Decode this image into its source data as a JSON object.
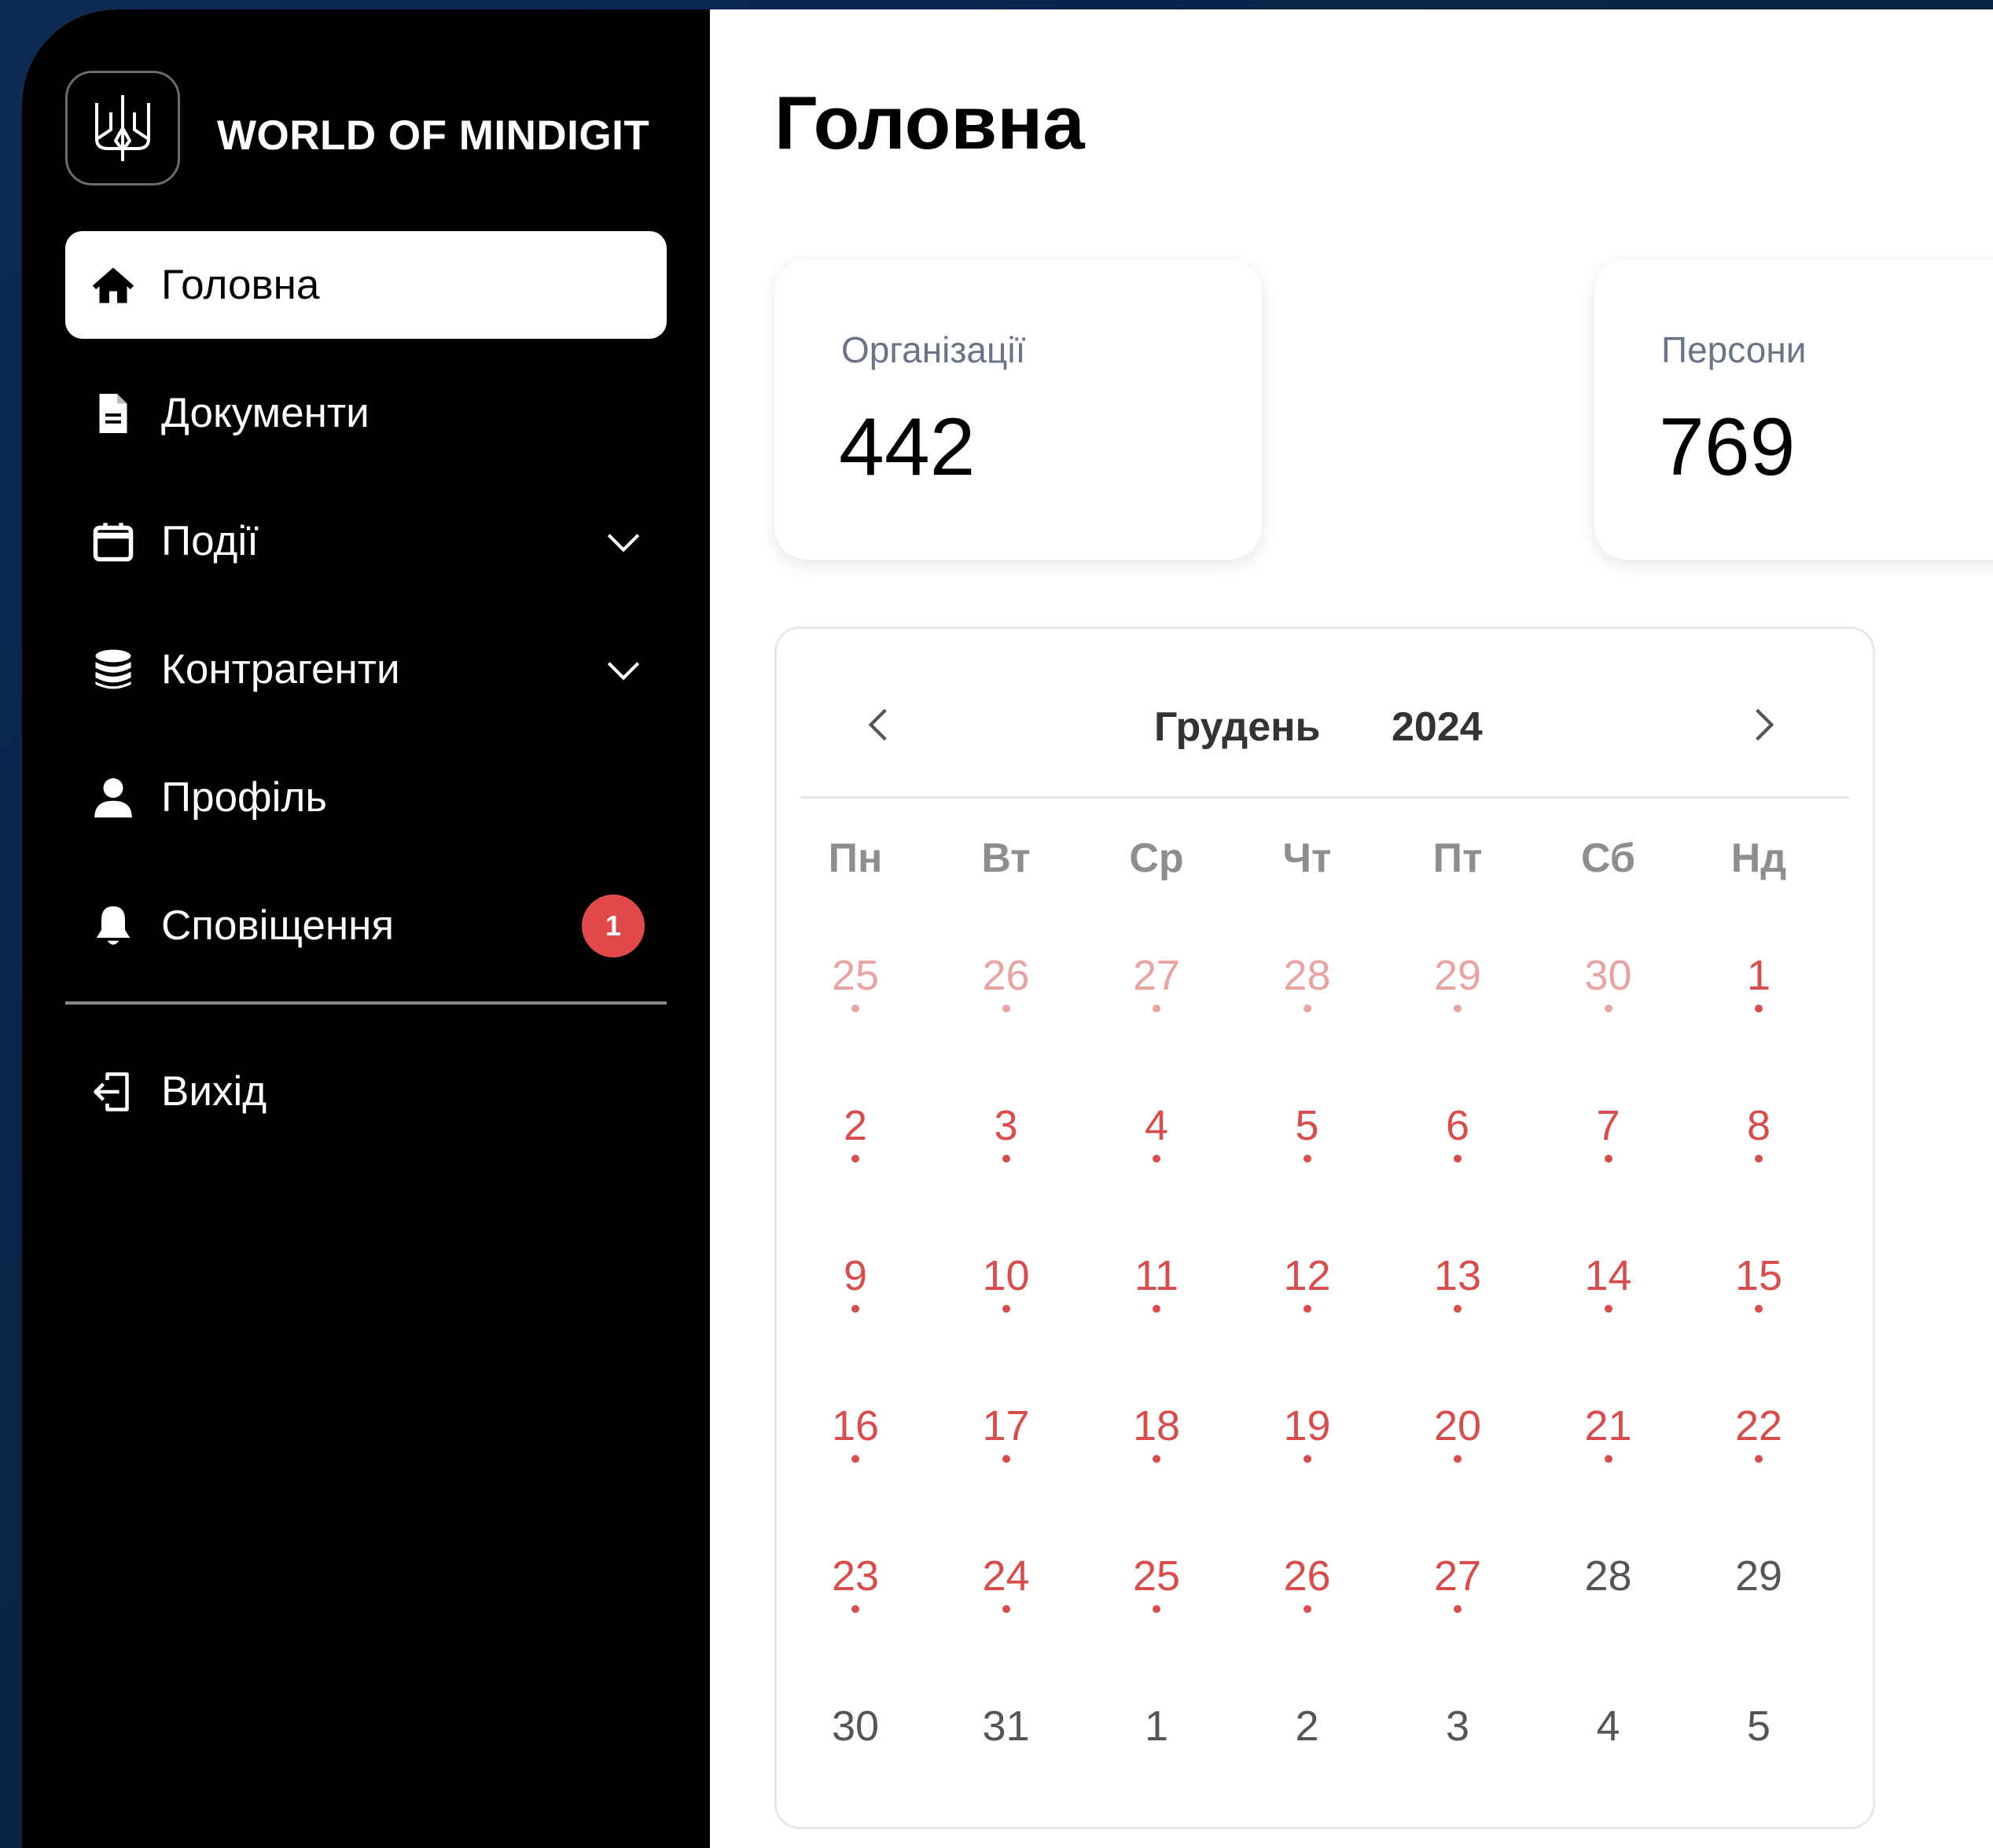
{
  "app": {
    "brand": "WORLD OF MINDIGIT"
  },
  "sidebar": {
    "items": [
      {
        "label": "Головна",
        "icon": "home-icon",
        "active": true
      },
      {
        "label": "Документи",
        "icon": "document-icon"
      },
      {
        "label": "Події",
        "icon": "calendar-icon",
        "expandable": true
      },
      {
        "label": "Контрагенти",
        "icon": "database-icon",
        "expandable": true
      },
      {
        "label": "Профіль",
        "icon": "user-icon"
      },
      {
        "label": "Сповіщення",
        "icon": "bell-icon",
        "badge": "1"
      }
    ],
    "logout": {
      "label": "Вихід",
      "icon": "logout-icon"
    }
  },
  "main": {
    "title": "Головна",
    "stats": [
      {
        "label": "Організації",
        "value": "442"
      },
      {
        "label": "Персони",
        "value": "769"
      }
    ],
    "calendar": {
      "month": "Грудень",
      "year": "2024",
      "weekdays": [
        "Пн",
        "Вт",
        "Ср",
        "Чт",
        "Пт",
        "Сб",
        "Нд"
      ],
      "days": [
        [
          "25",
          "26",
          "27",
          "28",
          "29",
          "30",
          "1"
        ],
        [
          "2",
          "3",
          "4",
          "5",
          "6",
          "7",
          "8"
        ],
        [
          "9",
          "10",
          "11",
          "12",
          "13",
          "14",
          "15"
        ],
        [
          "16",
          "17",
          "18",
          "19",
          "20",
          "21",
          "22"
        ],
        [
          "23",
          "24",
          "25",
          "26",
          "27",
          "28",
          "29"
        ],
        [
          "30",
          "31",
          "1",
          "2",
          "3",
          "4",
          "5"
        ]
      ],
      "colors": {
        "marked": "#d94c4c",
        "marked_faded": "#e8a3a3",
        "plain": "#555555"
      }
    }
  }
}
